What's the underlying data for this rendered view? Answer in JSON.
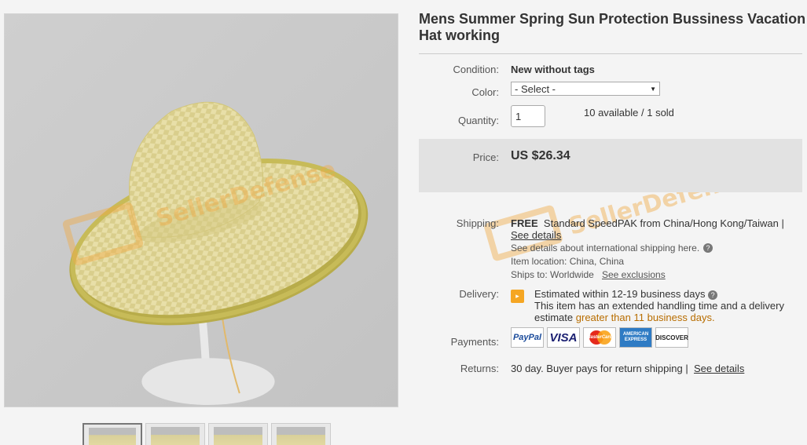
{
  "listing": {
    "title": "Mens Summer Spring Sun Protection Bussiness Vacation Hat working"
  },
  "thumbnails": [
    {
      "label": "thumb-1"
    },
    {
      "label": "thumb-2"
    },
    {
      "label": "thumb-3"
    },
    {
      "label": "thumb-4"
    }
  ],
  "condition": {
    "label": "Condition:",
    "value": "New without tags"
  },
  "color": {
    "label": "Color:",
    "selected": "- Select -"
  },
  "quantity": {
    "label": "Quantity:",
    "value": "1",
    "availability": "10 available / 1 sold"
  },
  "price": {
    "label": "Price:",
    "value": "US $26.34"
  },
  "shipping": {
    "label": "Shipping:",
    "free": "FREE",
    "service": "Standard SpeedPAK from China/Hong Kong/Taiwan |",
    "see_details": "See details",
    "intl_note": "See details about international shipping here.",
    "location": "Item location:  China, China",
    "ships_to": "Ships to:  Worldwide",
    "see_exclusions": "See exclusions"
  },
  "delivery": {
    "label": "Delivery:",
    "estimate": "Estimated within 12-19 business days",
    "handling_1": "This item has an extended handling time and a delivery",
    "handling_2_prefix": "estimate",
    "handling_2_highlight": "greater than 11 business days."
  },
  "payments": {
    "label": "Payments:",
    "logos": {
      "paypal": "PayPal",
      "visa": "VISA",
      "mastercard": "MasterCard",
      "amex": "AMERICAN EXPRESS",
      "discover": "DISCOVER"
    }
  },
  "returns": {
    "label": "Returns:",
    "text": "30 day. Buyer pays for return shipping |",
    "see_details": "See details"
  },
  "watermark": {
    "text": "SellerDefense"
  },
  "colors": {
    "accent_orange": "#b86d00",
    "price_box": "#e2e2e2",
    "delivery_icon": "#f5a623"
  }
}
